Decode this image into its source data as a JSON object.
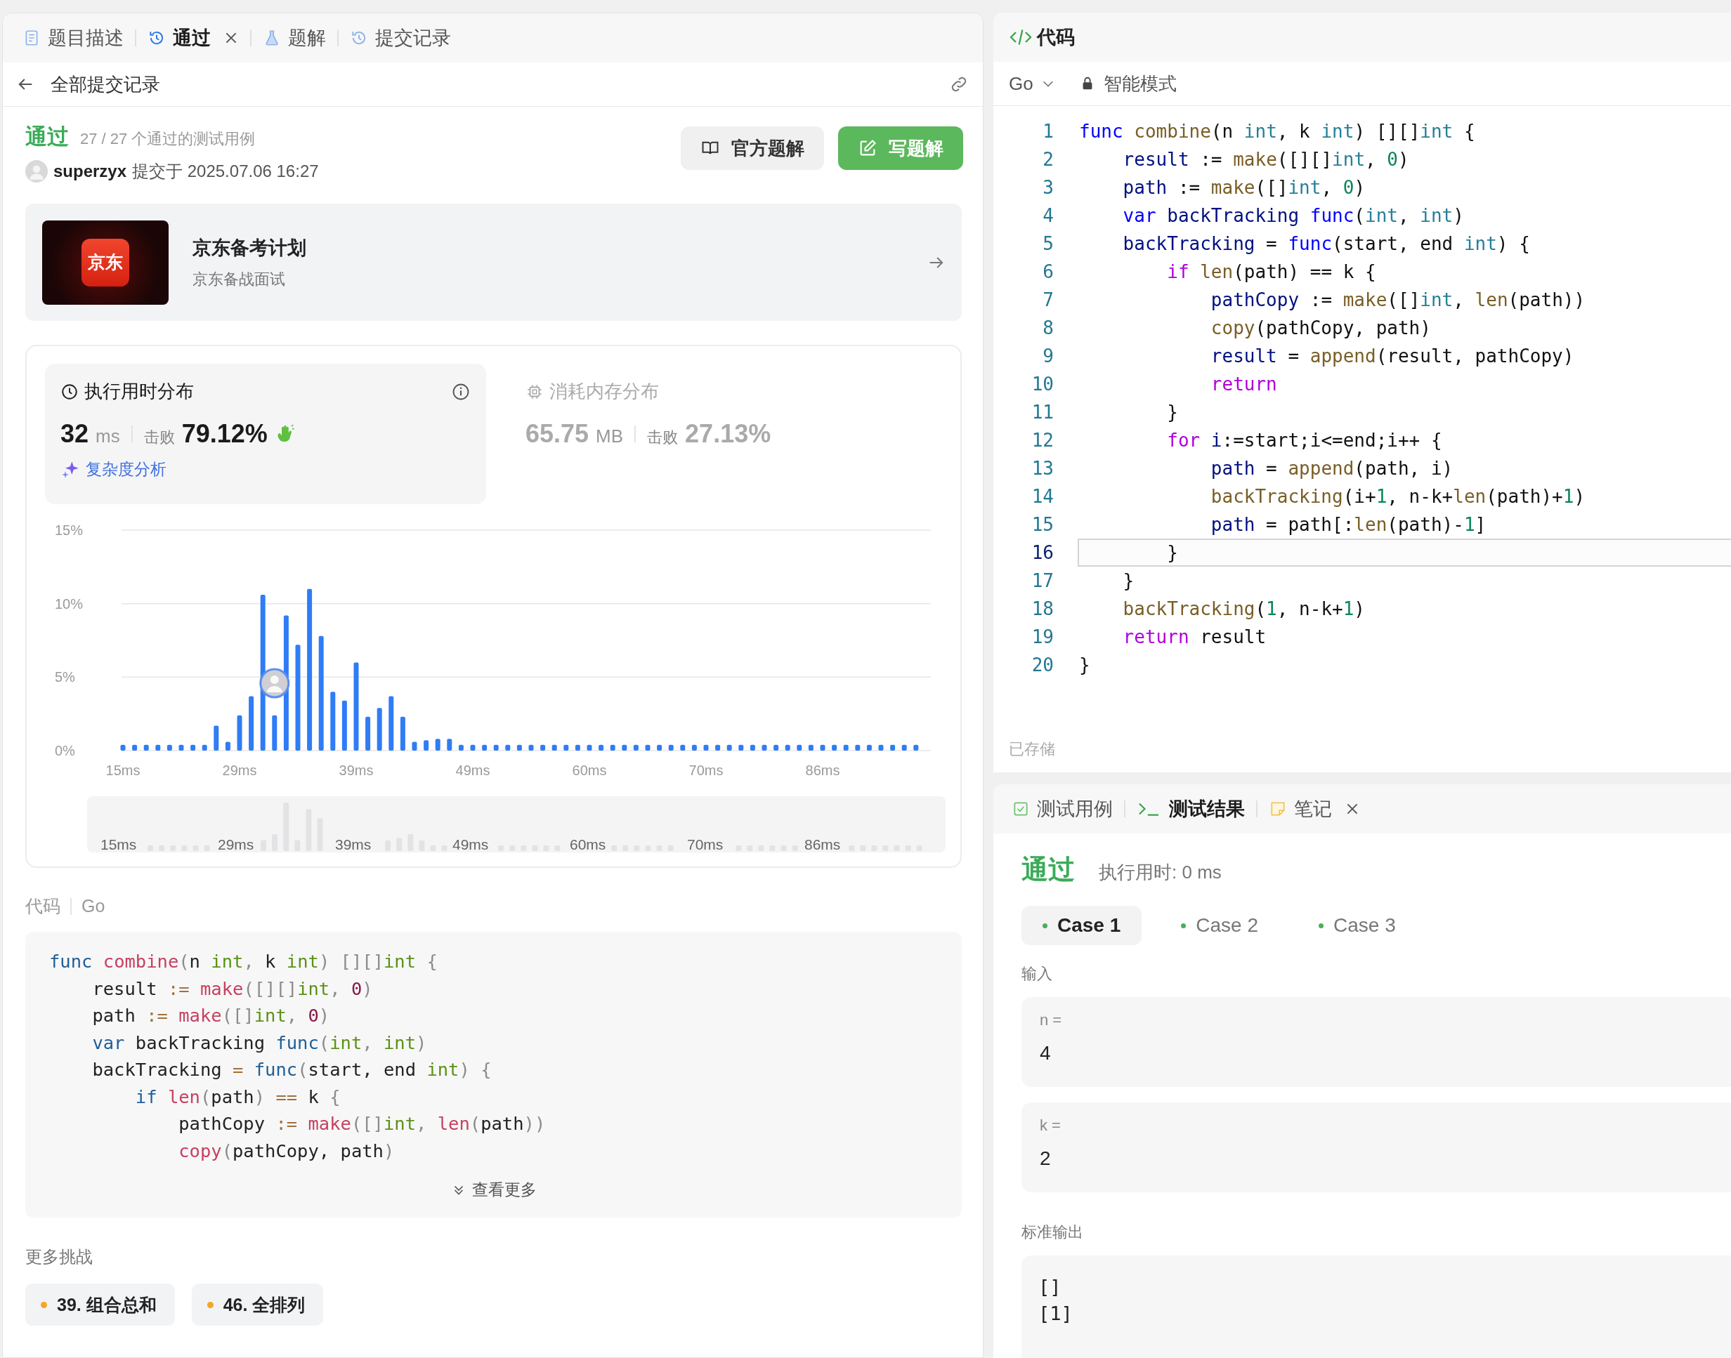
{
  "left_panel": {
    "tabs": [
      {
        "label": "题目描述",
        "kind": "description",
        "selected": false,
        "closable": false
      },
      {
        "label": "通过",
        "kind": "history",
        "selected": true,
        "closable": true
      },
      {
        "label": "题解",
        "kind": "solution",
        "selected": false,
        "closable": false
      },
      {
        "label": "提交记录",
        "kind": "history",
        "selected": false,
        "closable": false
      }
    ],
    "back_link": "全部提交记录",
    "result": {
      "status": "通过",
      "summary": "27 / 27 个通过的测试用例",
      "user": "superzyx",
      "submitted": "提交于 2025.07.06 16:27"
    },
    "buttons": [
      {
        "label": "官方题解",
        "kind": "secondary"
      },
      {
        "label": "写题解",
        "kind": "primary"
      }
    ],
    "promo": {
      "logo_text": "京东",
      "title": "京东备考计划",
      "subtitle": "京东备战面试"
    },
    "runtime": {
      "title": "执行用时分布",
      "value": "32",
      "unit": "ms",
      "beats_label": "击败",
      "beats": "79.12%",
      "link": "复杂度分析",
      "selected": true
    },
    "memory": {
      "title": "消耗内存分布",
      "value": "65.75",
      "unit": "MB",
      "beats_label": "击败",
      "beats": "27.13%",
      "selected": false
    },
    "chart_data": {
      "type": "bar",
      "categories": [
        "15ms",
        null,
        null,
        null,
        null,
        null,
        null,
        null,
        null,
        null,
        "29ms",
        null,
        null,
        null,
        null,
        null,
        null,
        null,
        null,
        null,
        "39ms",
        null,
        null,
        null,
        null,
        null,
        null,
        null,
        null,
        null,
        "49ms",
        null,
        null,
        null,
        null,
        null,
        null,
        null,
        null,
        null,
        "60ms",
        null,
        null,
        null,
        null,
        null,
        null,
        null,
        null,
        null,
        "70ms",
        null,
        null,
        null,
        null,
        null,
        null,
        null,
        null,
        null,
        "86ms",
        null,
        null,
        null,
        null,
        null,
        null,
        null,
        null
      ],
      "values": [
        0.4,
        0.4,
        0.4,
        0.4,
        0.4,
        0.4,
        0.4,
        0.4,
        1.7,
        0.6,
        2.4,
        3.7,
        10.6,
        2.4,
        9.2,
        7.2,
        11.0,
        7.8,
        4.0,
        3.4,
        6.0,
        2.3,
        2.9,
        3.7,
        2.3,
        0.6,
        0.7,
        0.8,
        0.8,
        0.4,
        0.4,
        0.4,
        0.4,
        0.4,
        0.4,
        0.4,
        0.4,
        0.4,
        0.4,
        0.4,
        0.4,
        0.4,
        0.4,
        0.4,
        0.4,
        0.4,
        0.4,
        0.4,
        0.4,
        0.4,
        0.4,
        0.4,
        0.4,
        0.4,
        0.4,
        0.4,
        0.4,
        0.4,
        0.4,
        0.4,
        0.4,
        0.4,
        0.4,
        0.4,
        0.4,
        0.4,
        0.4,
        0.4,
        0.4
      ],
      "ylim": [
        0,
        15
      ],
      "yticks": [
        {
          "value": 0,
          "label": "0%"
        },
        {
          "value": 5,
          "label": "5%"
        },
        {
          "value": 10,
          "label": "10%"
        },
        {
          "value": 15,
          "label": "15%"
        }
      ]
    },
    "overview_labels": [
      "15ms",
      "29ms",
      "39ms",
      "49ms",
      "60ms",
      "70ms",
      "86ms"
    ],
    "code_label": "代码",
    "code_language": "Go",
    "code_lines": [
      [
        {
          "text": "func",
          "kind": "keyword"
        },
        {
          "text": " combine",
          "kind": "function"
        },
        {
          "text": "(",
          "kind": "punct"
        },
        {
          "text": "n ",
          "kind": "plain"
        },
        {
          "text": "int",
          "kind": "type"
        },
        {
          "text": ", ",
          "kind": "punct"
        },
        {
          "text": "k ",
          "kind": "plain"
        },
        {
          "text": "int",
          "kind": "type"
        },
        {
          "text": ") [][]",
          "kind": "punct"
        },
        {
          "text": "int",
          "kind": "type"
        },
        {
          "text": " {",
          "kind": "punct"
        }
      ],
      [
        {
          "text": "    result ",
          "kind": "plain"
        },
        {
          "text": ":=",
          "kind": "operator"
        },
        {
          "text": " make",
          "kind": "function"
        },
        {
          "text": "([][]",
          "kind": "punct"
        },
        {
          "text": "int",
          "kind": "type"
        },
        {
          "text": ", ",
          "kind": "punct"
        },
        {
          "text": "0",
          "kind": "number"
        },
        {
          "text": ")",
          "kind": "punct"
        }
      ],
      [
        {
          "text": "    path ",
          "kind": "plain"
        },
        {
          "text": ":=",
          "kind": "operator"
        },
        {
          "text": " make",
          "kind": "function"
        },
        {
          "text": "([]",
          "kind": "punct"
        },
        {
          "text": "int",
          "kind": "type"
        },
        {
          "text": ", ",
          "kind": "punct"
        },
        {
          "text": "0",
          "kind": "number"
        },
        {
          "text": ")",
          "kind": "punct"
        }
      ],
      [
        {
          "text": "    var",
          "kind": "keyword"
        },
        {
          "text": " backTracking ",
          "kind": "plain"
        },
        {
          "text": "func",
          "kind": "keyword"
        },
        {
          "text": "(",
          "kind": "punct"
        },
        {
          "text": "int",
          "kind": "type"
        },
        {
          "text": ", ",
          "kind": "punct"
        },
        {
          "text": "int",
          "kind": "type"
        },
        {
          "text": ")",
          "kind": "punct"
        }
      ],
      [
        {
          "text": "    backTracking ",
          "kind": "plain"
        },
        {
          "text": "=",
          "kind": "operator"
        },
        {
          "text": " func",
          "kind": "keyword"
        },
        {
          "text": "(",
          "kind": "punct"
        },
        {
          "text": "start, end ",
          "kind": "plain"
        },
        {
          "text": "int",
          "kind": "type"
        },
        {
          "text": ") {",
          "kind": "punct"
        }
      ],
      [
        {
          "text": "        if",
          "kind": "control"
        },
        {
          "text": " len",
          "kind": "function"
        },
        {
          "text": "(",
          "kind": "punct"
        },
        {
          "text": "path",
          "kind": "plain"
        },
        {
          "text": ")",
          "kind": "punct"
        },
        {
          "text": " ==",
          "kind": "operator"
        },
        {
          "text": " k ",
          "kind": "plain"
        },
        {
          "text": "{",
          "kind": "punct"
        }
      ],
      [
        {
          "text": "            pathCopy ",
          "kind": "plain"
        },
        {
          "text": ":=",
          "kind": "operator"
        },
        {
          "text": " make",
          "kind": "function"
        },
        {
          "text": "([]",
          "kind": "punct"
        },
        {
          "text": "int",
          "kind": "type"
        },
        {
          "text": ", ",
          "kind": "punct"
        },
        {
          "text": "len",
          "kind": "function"
        },
        {
          "text": "(",
          "kind": "punct"
        },
        {
          "text": "path",
          "kind": "plain"
        },
        {
          "text": "))",
          "kind": "punct"
        }
      ],
      [
        {
          "text": "            copy",
          "kind": "function"
        },
        {
          "text": "(",
          "kind": "punct"
        },
        {
          "text": "pathCopy, path",
          "kind": "plain"
        },
        {
          "text": ")",
          "kind": "punct"
        }
      ]
    ],
    "show_more": "查看更多",
    "more_title": "更多挑战",
    "challenges": [
      "39. 组合总和",
      "46. 全排列"
    ]
  },
  "editor": {
    "title": "代码",
    "language": "Go",
    "mode": "智能模式",
    "status": "已存储",
    "lines": [
      {
        "number": "1",
        "current": false,
        "tokens": [
          {
            "text": "func",
            "kind": "keyword"
          },
          {
            "text": " combine",
            "kind": "function"
          },
          {
            "text": "(n ",
            "kind": "plain"
          },
          {
            "text": "int",
            "kind": "type"
          },
          {
            "text": ", k ",
            "kind": "plain"
          },
          {
            "text": "int",
            "kind": "type"
          },
          {
            "text": ") [][]",
            "kind": "plain"
          },
          {
            "text": "int",
            "kind": "type"
          },
          {
            "text": " {",
            "kind": "plain"
          }
        ]
      },
      {
        "number": "2",
        "current": false,
        "tokens": [
          {
            "text": "    result",
            "kind": "variable"
          },
          {
            "text": " := ",
            "kind": "plain"
          },
          {
            "text": "make",
            "kind": "function"
          },
          {
            "text": "([][]",
            "kind": "plain"
          },
          {
            "text": "int",
            "kind": "type"
          },
          {
            "text": ", ",
            "kind": "plain"
          },
          {
            "text": "0",
            "kind": "number"
          },
          {
            "text": ")",
            "kind": "plain"
          }
        ]
      },
      {
        "number": "3",
        "current": false,
        "tokens": [
          {
            "text": "    path",
            "kind": "variable"
          },
          {
            "text": " := ",
            "kind": "plain"
          },
          {
            "text": "make",
            "kind": "function"
          },
          {
            "text": "([]",
            "kind": "plain"
          },
          {
            "text": "int",
            "kind": "type"
          },
          {
            "text": ", ",
            "kind": "plain"
          },
          {
            "text": "0",
            "kind": "number"
          },
          {
            "text": ")",
            "kind": "plain"
          }
        ]
      },
      {
        "number": "4",
        "current": false,
        "tokens": [
          {
            "text": "    var",
            "kind": "keyword"
          },
          {
            "text": " backTracking ",
            "kind": "variable"
          },
          {
            "text": "func",
            "kind": "keyword"
          },
          {
            "text": "(",
            "kind": "plain"
          },
          {
            "text": "int",
            "kind": "type"
          },
          {
            "text": ", ",
            "kind": "plain"
          },
          {
            "text": "int",
            "kind": "type"
          },
          {
            "text": ")",
            "kind": "plain"
          }
        ]
      },
      {
        "number": "5",
        "current": false,
        "tokens": [
          {
            "text": "    backTracking",
            "kind": "variable"
          },
          {
            "text": " = ",
            "kind": "plain"
          },
          {
            "text": "func",
            "kind": "keyword"
          },
          {
            "text": "(start, end ",
            "kind": "plain"
          },
          {
            "text": "int",
            "kind": "type"
          },
          {
            "text": ") {",
            "kind": "plain"
          }
        ]
      },
      {
        "number": "6",
        "current": false,
        "tokens": [
          {
            "text": "        if",
            "kind": "control"
          },
          {
            "text": " len",
            "kind": "function"
          },
          {
            "text": "(path) == k {",
            "kind": "plain"
          }
        ]
      },
      {
        "number": "7",
        "current": false,
        "tokens": [
          {
            "text": "            pathCopy",
            "kind": "variable"
          },
          {
            "text": " := ",
            "kind": "plain"
          },
          {
            "text": "make",
            "kind": "function"
          },
          {
            "text": "([]",
            "kind": "plain"
          },
          {
            "text": "int",
            "kind": "type"
          },
          {
            "text": ", ",
            "kind": "plain"
          },
          {
            "text": "len",
            "kind": "function"
          },
          {
            "text": "(path))",
            "kind": "plain"
          }
        ]
      },
      {
        "number": "8",
        "current": false,
        "tokens": [
          {
            "text": "            copy",
            "kind": "function"
          },
          {
            "text": "(pathCopy, path)",
            "kind": "plain"
          }
        ]
      },
      {
        "number": "9",
        "current": false,
        "tokens": [
          {
            "text": "            result",
            "kind": "variable"
          },
          {
            "text": " = ",
            "kind": "plain"
          },
          {
            "text": "append",
            "kind": "function"
          },
          {
            "text": "(result, pathCopy)",
            "kind": "plain"
          }
        ]
      },
      {
        "number": "10",
        "current": false,
        "tokens": [
          {
            "text": "            return",
            "kind": "control"
          }
        ]
      },
      {
        "number": "11",
        "current": false,
        "tokens": [
          {
            "text": "        }",
            "kind": "plain"
          }
        ]
      },
      {
        "number": "12",
        "current": false,
        "tokens": [
          {
            "text": "        for",
            "kind": "control"
          },
          {
            "text": " i",
            "kind": "variable"
          },
          {
            "text": ":=start;i<=end;i++ {",
            "kind": "plain"
          }
        ]
      },
      {
        "number": "13",
        "current": false,
        "tokens": [
          {
            "text": "            path",
            "kind": "variable"
          },
          {
            "text": " = ",
            "kind": "plain"
          },
          {
            "text": "append",
            "kind": "function"
          },
          {
            "text": "(path, i)",
            "kind": "plain"
          }
        ]
      },
      {
        "number": "14",
        "current": false,
        "tokens": [
          {
            "text": "            backTracking",
            "kind": "function"
          },
          {
            "text": "(i+",
            "kind": "plain"
          },
          {
            "text": "1",
            "kind": "number"
          },
          {
            "text": ", n-k+",
            "kind": "plain"
          },
          {
            "text": "len",
            "kind": "function"
          },
          {
            "text": "(path)+",
            "kind": "plain"
          },
          {
            "text": "1",
            "kind": "number"
          },
          {
            "text": ")",
            "kind": "plain"
          }
        ]
      },
      {
        "number": "15",
        "current": false,
        "tokens": [
          {
            "text": "            path",
            "kind": "variable"
          },
          {
            "text": " = path[:",
            "kind": "plain"
          },
          {
            "text": "len",
            "kind": "function"
          },
          {
            "text": "(path)-",
            "kind": "plain"
          },
          {
            "text": "1",
            "kind": "number"
          },
          {
            "text": "]",
            "kind": "plain"
          }
        ]
      },
      {
        "number": "16",
        "current": true,
        "tokens": [
          {
            "text": "        }",
            "kind": "plain"
          }
        ]
      },
      {
        "number": "17",
        "current": false,
        "tokens": [
          {
            "text": "    }",
            "kind": "plain"
          }
        ]
      },
      {
        "number": "18",
        "current": false,
        "tokens": [
          {
            "text": "    backTracking",
            "kind": "function"
          },
          {
            "text": "(",
            "kind": "plain"
          },
          {
            "text": "1",
            "kind": "number"
          },
          {
            "text": ", n-k+",
            "kind": "plain"
          },
          {
            "text": "1",
            "kind": "number"
          },
          {
            "text": ")",
            "kind": "plain"
          }
        ]
      },
      {
        "number": "19",
        "current": false,
        "tokens": [
          {
            "text": "    return",
            "kind": "control"
          },
          {
            "text": " result",
            "kind": "plain"
          }
        ]
      },
      {
        "number": "20",
        "current": false,
        "tokens": [
          {
            "text": "}",
            "kind": "plain"
          }
        ]
      }
    ]
  },
  "console": {
    "tabs": [
      {
        "label": "测试用例",
        "kind": "testcase",
        "selected": false,
        "closable": false
      },
      {
        "label": "测试结果",
        "kind": "result",
        "selected": true,
        "closable": false
      },
      {
        "label": "笔记",
        "kind": "note",
        "selected": false,
        "closable": true
      }
    ],
    "status": "通过",
    "runtime": "执行用时: 0 ms",
    "cases": [
      {
        "label": "Case 1",
        "selected": true
      },
      {
        "label": "Case 2",
        "selected": false
      },
      {
        "label": "Case 3",
        "selected": false
      }
    ],
    "input_label": "输入",
    "inputs": [
      {
        "name": "n =",
        "value": "4"
      },
      {
        "name": "k =",
        "value": "2"
      }
    ],
    "output_label": "标准输出",
    "output_lines": [
      "[]",
      "[1]"
    ]
  }
}
